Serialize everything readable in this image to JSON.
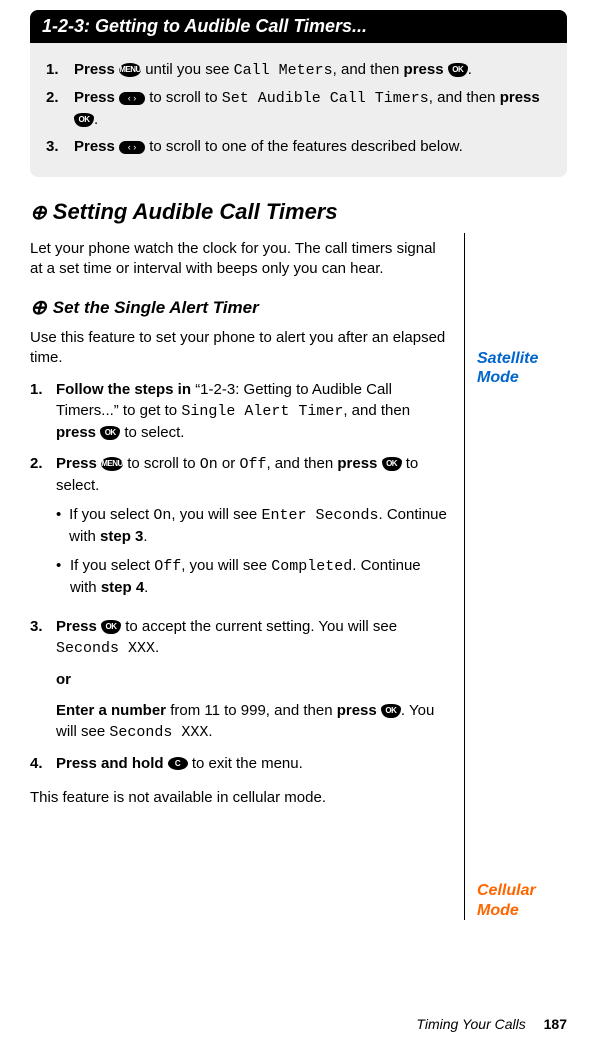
{
  "header": {
    "title_prefix": "1-2-3:",
    "title_rest": " Getting to Audible Call Timers..."
  },
  "greysteps": [
    {
      "num": "1.",
      "pre": "Press ",
      "icon1": "MENU",
      "mid1": " until you see ",
      "lcd1": "Call Meters",
      "mid2": ", and then ",
      "bold2": "press ",
      "icon2": "OK",
      "post": "."
    },
    {
      "num": "2.",
      "pre": "Press ",
      "icon1": "SCROLL",
      "mid1": " to scroll to ",
      "lcd1": "Set Audible Call Timers",
      "mid2": ", and then ",
      "bold2": "press ",
      "icon2": "OK",
      "post": "."
    },
    {
      "num": "3.",
      "pre": "Press ",
      "icon1": "SCROLL",
      "mid1": " to scroll to one of the features described below.",
      "lcd1": "",
      "mid2": "",
      "bold2": "",
      "icon2": "",
      "post": ""
    }
  ],
  "section": {
    "globe": "⊕",
    "title": "Setting Audible Call Timers",
    "intro": "Let your phone watch the clock for you. The call timers signal at a set time or interval with beeps only you can hear."
  },
  "subsection": {
    "globe": "⊕",
    "title": "Set the Single Alert Timer",
    "intro": "Use this feature to set your phone to alert you after an elapsed time.",
    "sat_label": "Satellite Mode",
    "cell_label": "Cellular Mode"
  },
  "mainsteps": {
    "s1": {
      "num": "1.",
      "bold1": "Follow the steps in ",
      "quote": "“1-2-3: Getting to Audible Call Timers...” to get to ",
      "lcd": "Single Alert Timer",
      "mid": ", and then ",
      "bold2": "press ",
      "post": " to select."
    },
    "s2": {
      "num": "2.",
      "bold1": "Press ",
      "mid1": " to scroll to ",
      "lcd1": "On",
      "or": " or ",
      "lcd2": "Off",
      "mid2": ", and then ",
      "bold2": "press ",
      "post": " to select."
    },
    "bullet1": {
      "pre": "If you select ",
      "lcd1": "On",
      "mid1": ", you will see ",
      "lcd2": "Enter Seconds",
      "post1": ". Continue with ",
      "boldstep": "step 3",
      "post2": "."
    },
    "bullet2": {
      "pre": "If you select ",
      "lcd1": "Off",
      "mid1": ", you will see ",
      "lcd2": "Completed",
      "post1": ". Continue with ",
      "boldstep": "step 4",
      "post2": "."
    },
    "s3": {
      "num": "3.",
      "bold1": "Press ",
      "mid1": " to accept the current setting. You will see ",
      "lcd1": "Seconds XXX",
      "post1": ".",
      "or": "or",
      "bold2": "Enter a number",
      "mid2": " from 11 to 999, and then ",
      "bold3": "press ",
      "post2": ". You will see ",
      "lcd2": "Seconds XXX",
      "post3": "."
    },
    "s4": {
      "num": "4.",
      "bold1": "Press and hold ",
      "post": " to exit the menu."
    }
  },
  "cell_note": "This feature is not available in cellular mode.",
  "footer": {
    "text": "Timing Your Calls",
    "page": "187"
  },
  "icons": {
    "menu": "MENU",
    "ok": "OK",
    "scroll_l": "‹",
    "scroll_r": "›",
    "c": "C"
  }
}
